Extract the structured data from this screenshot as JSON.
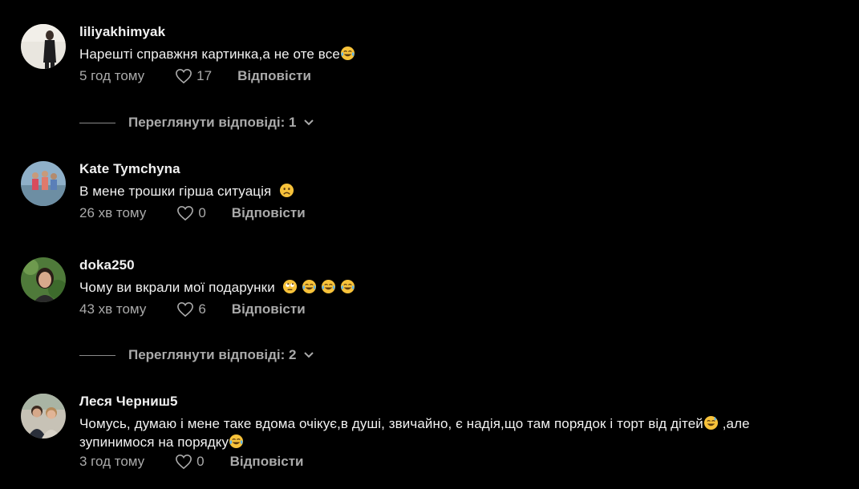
{
  "comments": [
    {
      "username": "liliyakhimyak",
      "text": "Нарешті справжня картинка,а не оте все",
      "emojis": [
        "tears-of-joy"
      ],
      "time": "5 год тому",
      "likes": "17",
      "reply_label": "Відповісти",
      "replies_label": "Переглянути відповіді: 1"
    },
    {
      "username": "Kate Tymchyna",
      "text": "В мене трошки гірша ситуація",
      "emojis": [
        "frowning-face"
      ],
      "time": "26 хв тому",
      "likes": "0",
      "reply_label": "Відповісти"
    },
    {
      "username": "doka250",
      "text": "Чому ви вкрали мої подарунки",
      "emojis": [
        "rolling-eyes",
        "tears-of-joy",
        "tears-of-joy",
        "tears-of-joy"
      ],
      "time": "43 хв тому",
      "likes": "6",
      "reply_label": "Відповісти",
      "replies_label": "Переглянути відповіді: 2"
    },
    {
      "username": "Леся Черниш5",
      "text_line1": "Чомусь, думаю і мене таке вдома очікує,в душі, звичайно, є надія,що там порядок і торт від дітей",
      "text_line1_tail": ",але",
      "text_line2": "зупинимося на порядку",
      "emojis": [
        "grinning-sweat",
        "tears-of-joy"
      ],
      "time": "3 год тому",
      "likes": "0",
      "reply_label": "Відповісти"
    }
  ],
  "colors": {
    "background": "#000000",
    "primary_text": "#f1f1f1",
    "secondary_text": "#aaaaaa",
    "emoji_yellow": "#f7c23a"
  }
}
